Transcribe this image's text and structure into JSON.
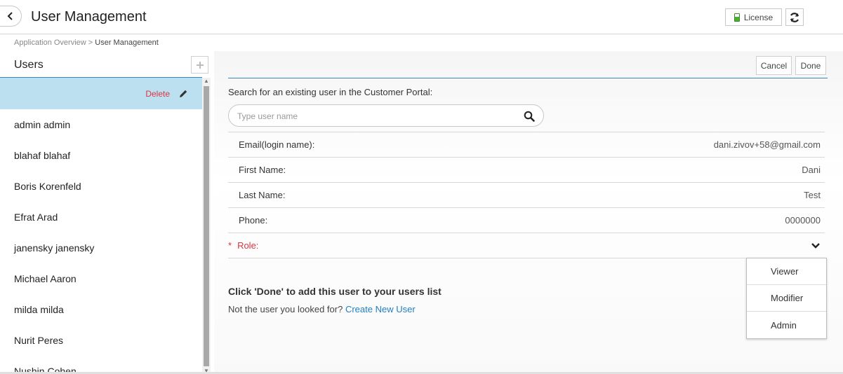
{
  "header": {
    "title": "User Management",
    "license_label": "License",
    "icons": {
      "back": "chevron-left-icon",
      "license": "battery-icon",
      "refresh": "refresh-icon"
    }
  },
  "breadcrumb": {
    "parent": "Application Overview",
    "separator": ">",
    "current": "User Management"
  },
  "sidebar": {
    "heading": "Users",
    "delete_label": "Delete",
    "users": [
      "admin admin",
      "blahaf blahaf",
      "Boris Korenfeld",
      "Efrat Arad",
      "janensky janensky",
      "Michael Aaron",
      "milda milda",
      "Nurit Peres",
      "Nushin Cohen"
    ]
  },
  "main": {
    "cancel_label": "Cancel",
    "done_label": "Done",
    "search_label": "Search for an existing user in the Customer Portal:",
    "search_placeholder": "Type user name",
    "search_value": "",
    "fields": [
      {
        "label": "Email(login name):",
        "value": "dani.zivov+58@gmail.com"
      },
      {
        "label": "First Name:",
        "value": "Dani"
      },
      {
        "label": "Last Name:",
        "value": "Test"
      },
      {
        "label": "Phone:",
        "value": "0000000"
      }
    ],
    "role_label": "Role:",
    "required_mark": "*",
    "role_options": [
      "Viewer",
      "Modifier",
      "Admin"
    ],
    "hint": "Click 'Done' to add this user to your users list",
    "not_user_text": "Not the user you looked for?",
    "create_link": "Create New User"
  },
  "colors": {
    "accent": "#3a86b8",
    "selected": "#bde0f0",
    "danger": "#d8343f",
    "link": "#1f7fc4"
  }
}
